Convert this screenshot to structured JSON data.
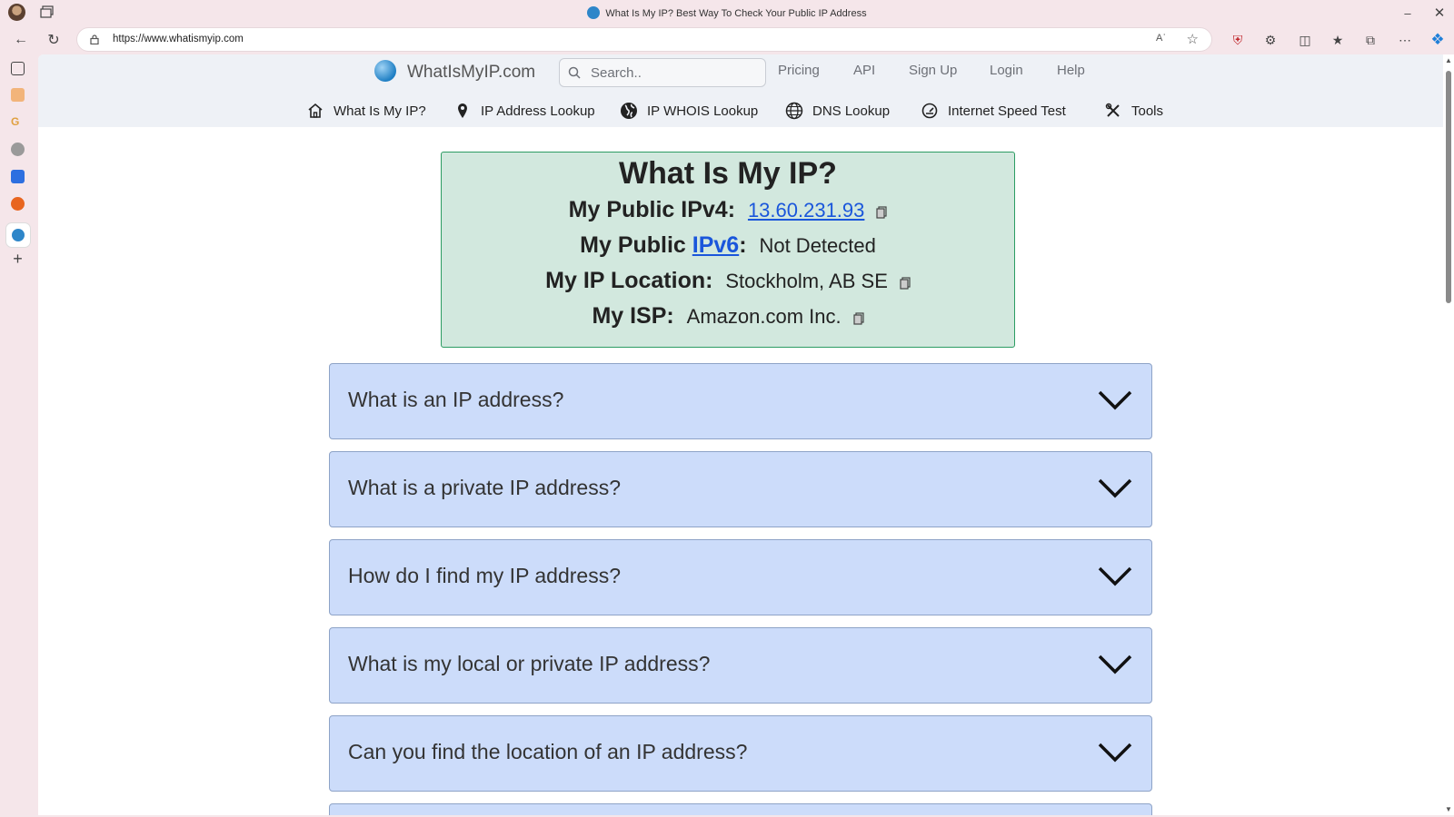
{
  "browser": {
    "window_title": "What Is My IP? Best Way To Check Your Public IP Address",
    "url": "https://www.whatismyip.com",
    "read_aloud": "Aʾ"
  },
  "site": {
    "logo_text": "WhatIsMyIP.com",
    "search_placeholder": "Search..",
    "top_links": [
      "Pricing",
      "API",
      "Sign Up",
      "Login",
      "Help"
    ],
    "nav": [
      {
        "label": "What Is My IP?",
        "icon": "home-icon"
      },
      {
        "label": "IP Address Lookup",
        "icon": "map-pin-icon"
      },
      {
        "label": "IP WHOIS Lookup",
        "icon": "earth-icon"
      },
      {
        "label": "DNS Lookup",
        "icon": "globe-grid-icon"
      },
      {
        "label": "Internet Speed Test",
        "icon": "speedometer-icon"
      },
      {
        "label": "Tools",
        "icon": "tools-icon"
      }
    ]
  },
  "ip_info": {
    "heading": "What Is My IP?",
    "ipv4_label": "My Public IPv4:",
    "ipv4_value": "13.60.231.93",
    "ipv6_label_prefix": "My Public ",
    "ipv6_link": "IPv6",
    "ipv6_label_suffix": ":",
    "ipv6_value": "Not Detected",
    "location_label": "My IP Location:",
    "location_value": "Stockholm, AB SE",
    "isp_label": "My ISP:",
    "isp_value": "Amazon.com Inc."
  },
  "faq": [
    "What is an IP address?",
    "What is a private IP address?",
    "How do I find my IP address?",
    "What is my local or private IP address?",
    "Can you find the location of an IP address?"
  ],
  "colors": {
    "ip_box_bg": "#d2e8de",
    "ip_box_border": "#2c9c63",
    "faq_bg": "#ccdcfa",
    "link": "#1a56db"
  }
}
